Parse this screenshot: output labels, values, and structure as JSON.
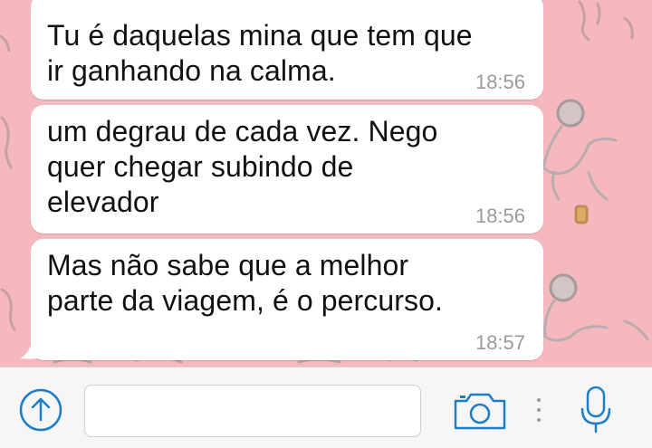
{
  "chat": {
    "messages": [
      {
        "text": "Tu é daquelas mina que tem que\nir ganhando na calma.",
        "time": "18:56"
      },
      {
        "text": "um degrau de cada vez. Nego\nquer chegar subindo de\nelevador",
        "time": "18:56"
      },
      {
        "text": "Mas não sabe que a melhor\nparte da viagem, é o percurso.",
        "time": "18:57"
      }
    ],
    "wallpaper_color": "#f4b8be"
  },
  "input_bar": {
    "message_placeholder": "",
    "attach_icon": "arrow-up-circle-icon",
    "camera_icon": "camera-icon",
    "mic_icon": "microphone-icon",
    "accent_color": "#1d7ec8"
  }
}
